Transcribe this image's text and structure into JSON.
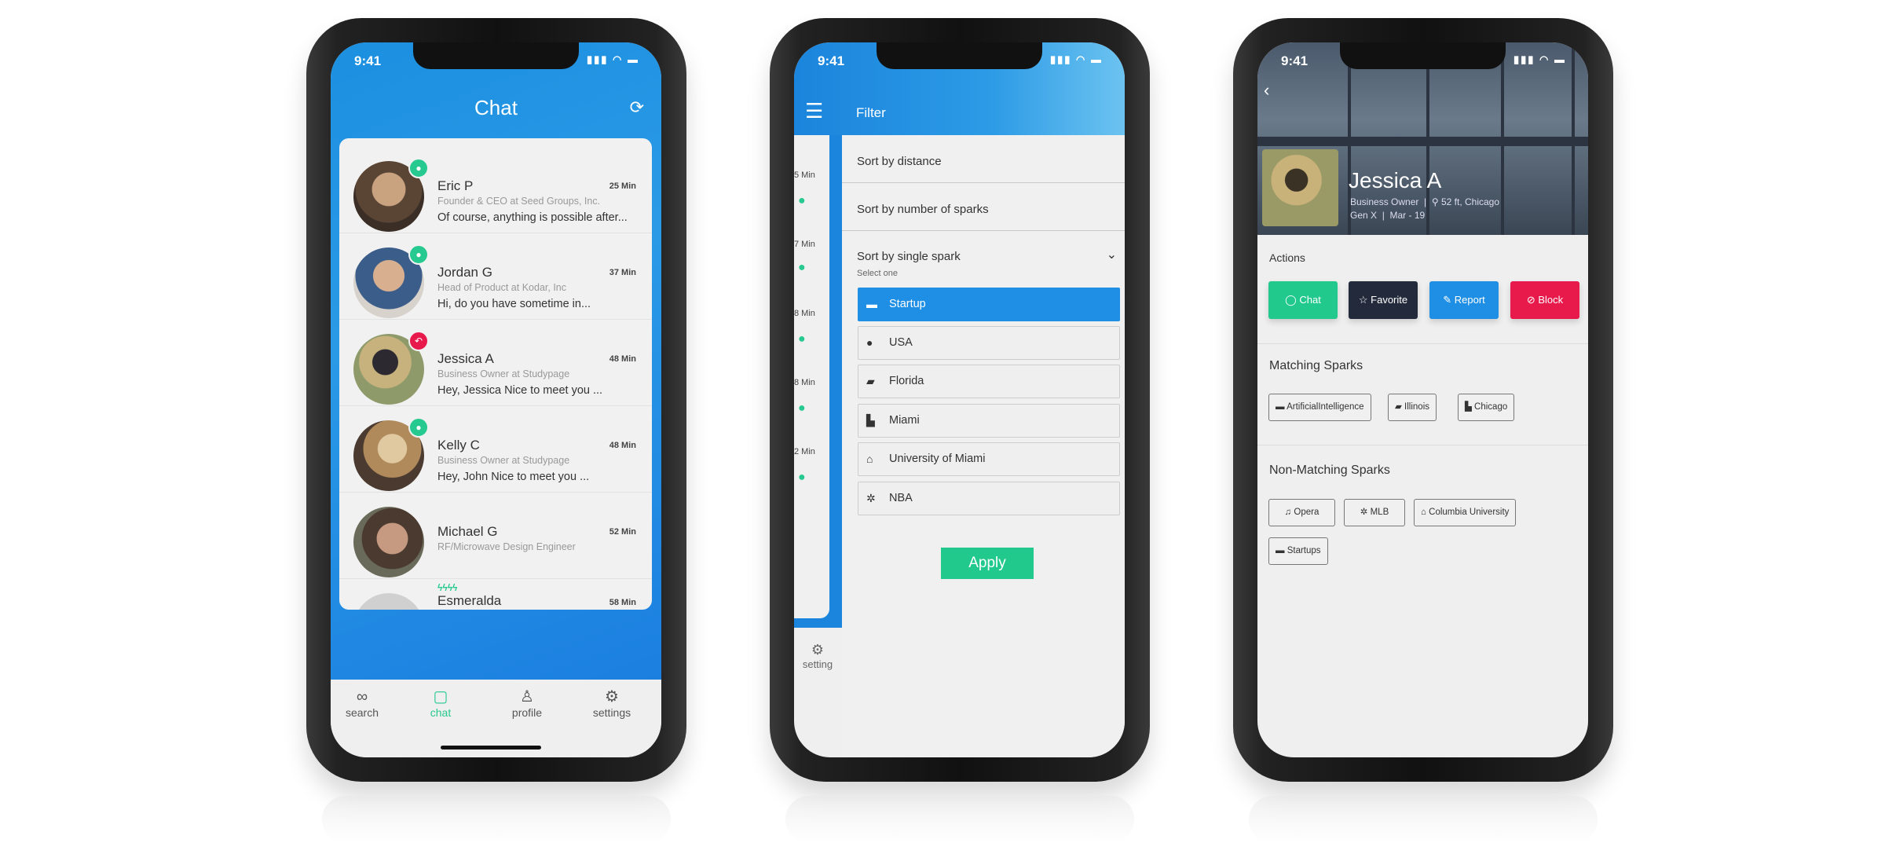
{
  "status_time": "9:41",
  "colors": {
    "primary_blue": "#1e8fe5",
    "accent_green": "#22c98c",
    "danger_red": "#e8194b",
    "dark_navy": "#232a3b"
  },
  "chat_screen": {
    "title": "Chat",
    "refresh_icon": "refresh-icon",
    "conversations": [
      {
        "name": "Eric P",
        "subtitle": "Founder & CEO at Seed Groups, Inc.",
        "message": "Of course, anything is possible after...",
        "time": "25 Min",
        "badge": "message"
      },
      {
        "name": "Jordan G",
        "subtitle": "Head of Product at Kodar, Inc",
        "message": "Hi, do you have sometime in...",
        "time": "37 Min",
        "badge": "message"
      },
      {
        "name": "Jessica A",
        "subtitle": "Business Owner at Studypage",
        "message": "Hey, Jessica Nice to meet you ...",
        "time": "48 Min",
        "badge": "reply"
      },
      {
        "name": "Kelly C",
        "subtitle": "Business Owner at Studypage",
        "message": "Hey, John Nice to meet you ...",
        "time": "48 Min",
        "badge": "message"
      },
      {
        "name": "Michael G",
        "subtitle": "RF/Microwave Design Engineer",
        "message": "",
        "time": "52 Min",
        "badge": ""
      },
      {
        "name": "Esmeralda",
        "subtitle": "",
        "message": "",
        "time": "58 Min",
        "badge": "sparks"
      }
    ],
    "tabs": [
      {
        "label": "search",
        "icon": "binoculars-icon",
        "active": false
      },
      {
        "label": "chat",
        "icon": "chat-icon",
        "active": true
      },
      {
        "label": "profile",
        "icon": "user-icon",
        "active": false
      },
      {
        "label": "settings",
        "icon": "gear-icon",
        "active": false
      }
    ]
  },
  "filter_screen": {
    "title": "Filter",
    "peek_times": [
      "5 Min",
      "7 Min",
      "8 Min",
      "8 Min",
      "2 Min"
    ],
    "peek_setting_label": "setting",
    "sort_by_distance": "Sort by distance",
    "sort_by_sparks": "Sort by number of sparks",
    "sort_by_single": "Sort by single spark",
    "select_one": "Select one",
    "options": [
      {
        "label": "Startup",
        "icon": "briefcase-icon",
        "selected": true
      },
      {
        "label": "USA",
        "icon": "globe-icon",
        "selected": false
      },
      {
        "label": "Florida",
        "icon": "us-map-icon",
        "selected": false
      },
      {
        "label": "Miami",
        "icon": "city-icon",
        "selected": false
      },
      {
        "label": "University of Miami",
        "icon": "university-icon",
        "selected": false
      },
      {
        "label": "NBA",
        "icon": "basketball-icon",
        "selected": false
      }
    ],
    "apply_label": "Apply"
  },
  "profile_screen": {
    "name": "Jessica A",
    "role": "Business Owner",
    "location": "52 ft, Chicago",
    "generation": "Gen X",
    "date": "Mar - 19",
    "actions_title": "Actions",
    "actions": [
      {
        "label": "Chat",
        "icon": "chat-icon",
        "color": "#22c98c"
      },
      {
        "label": "Favorite",
        "icon": "bookmark-star-icon",
        "color": "#232a3b"
      },
      {
        "label": "Report",
        "icon": "report-icon",
        "color": "#1e8fe5"
      },
      {
        "label": "Block",
        "icon": "block-icon",
        "color": "#e8194b"
      }
    ],
    "matching_title": "Matching Sparks",
    "matching": [
      {
        "label": "ArtificialIntelligence",
        "icon": "briefcase-icon"
      },
      {
        "label": "Illinois",
        "icon": "us-map-icon"
      },
      {
        "label": "Chicago",
        "icon": "city-icon"
      }
    ],
    "non_matching_title": "Non-Matching Sparks",
    "non_matching": [
      {
        "label": "Opera",
        "icon": "music-note-icon"
      },
      {
        "label": "MLB",
        "icon": "baseball-icon"
      },
      {
        "label": "Columbia University",
        "icon": "university-icon"
      },
      {
        "label": "Startups",
        "icon": "briefcase-icon"
      }
    ]
  }
}
